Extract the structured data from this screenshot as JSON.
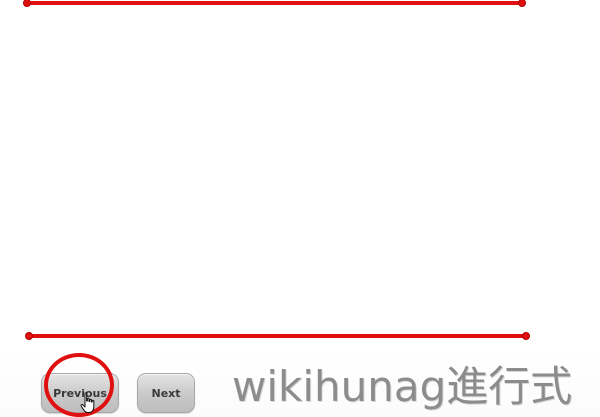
{
  "navigation": {
    "previous_label": "Previous",
    "next_label": "Next"
  },
  "watermark": {
    "text": "wikihunag進行式"
  },
  "icons": {
    "cursor": "hand-pointer-icon",
    "highlight": "highlight-circle"
  },
  "colors": {
    "guide_line": "#e01010",
    "button_face": "#c9c9c9",
    "watermark": "#8c8c8c"
  }
}
